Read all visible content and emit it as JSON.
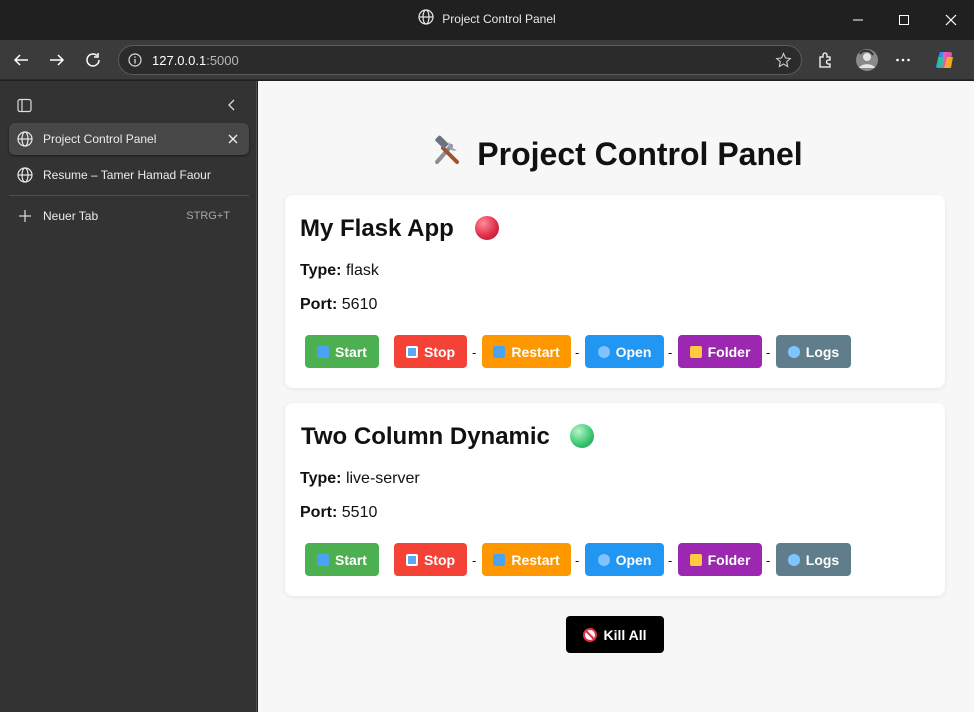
{
  "window": {
    "title": "Project Control Panel"
  },
  "toolbar": {
    "url_host": "127.0.0.1",
    "url_port": ":5000"
  },
  "sidebar": {
    "tabs": [
      {
        "label": "Project Control Panel",
        "active": true
      },
      {
        "label": "Resume – Tamer Hamad Faour",
        "active": false
      }
    ],
    "new_tab": {
      "label": "Neuer Tab",
      "shortcut": "STRG+T"
    }
  },
  "page": {
    "title": "Project Control Panel",
    "type_label": "Type:",
    "port_label": "Port:",
    "separator": "-",
    "projects": [
      {
        "name": "My Flask App",
        "status": "stopped",
        "status_color": "#e0304a",
        "type": "flask",
        "port": "5610"
      },
      {
        "name": "Two Column Dynamic",
        "status": "running",
        "status_color": "#3dca74",
        "type": "live-server",
        "port": "5510"
      }
    ],
    "buttons": {
      "start": "Start",
      "stop": "Stop",
      "restart": "Restart",
      "open": "Open",
      "folder": "Folder",
      "logs": "Logs"
    },
    "kill_all": "Kill All"
  },
  "colors": {
    "start": "#4caf50",
    "stop": "#f44336",
    "restart": "#ff9800",
    "open": "#2196f3",
    "folder": "#9c27b0",
    "logs": "#607d8b",
    "kill": "#000000"
  }
}
